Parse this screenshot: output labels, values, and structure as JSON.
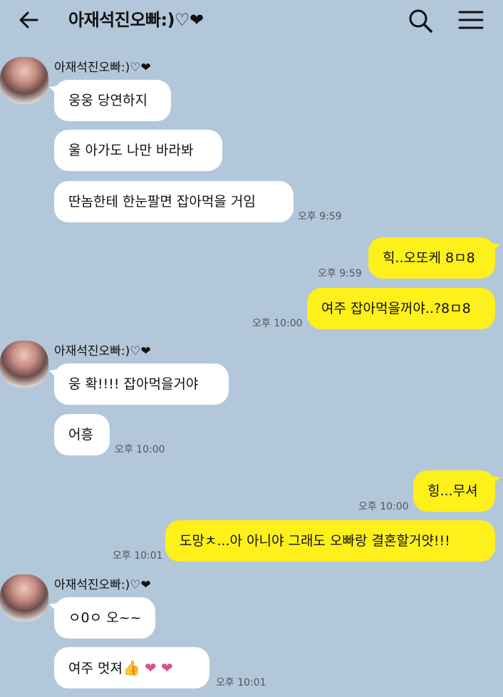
{
  "header": {
    "title": "아재석진오빠:)♡❤"
  },
  "sender_name": "아재석진오빠:)♡❤",
  "messages": [
    {
      "text": "웅웅 당연하지"
    },
    {
      "text": "울 아가도 나만 바라봐"
    },
    {
      "text": "딴놈한테 한눈팔면 잡아먹을 거임",
      "time": "오후 9:59"
    },
    {
      "text": "힉..오또케 8ㅁ8",
      "time": "오후 9:59"
    },
    {
      "text": "여주 잡아먹을꺼야..?8ㅁ8",
      "time": "오후 10:00"
    },
    {
      "text": "웅 확!!!! 잡아먹을거야"
    },
    {
      "text": "어흥",
      "time": "오후 10:00"
    },
    {
      "text": "힝...무셔",
      "time": "오후 10:00"
    },
    {
      "text": "도망ㅊ...아 아니야 그래도 오빠랑 결혼할거얏!!!",
      "time": "오후 10:01"
    },
    {
      "text": "ㅇ0ㅇ 오~~"
    },
    {
      "text": "여주 멋져",
      "emoji": "👍",
      "hearts": "❤ ❤",
      "time": "오후 10:01"
    }
  ],
  "colors": {
    "background": "#b2c7da",
    "received_bubble": "#ffffff",
    "sent_bubble": "#fef01b"
  }
}
